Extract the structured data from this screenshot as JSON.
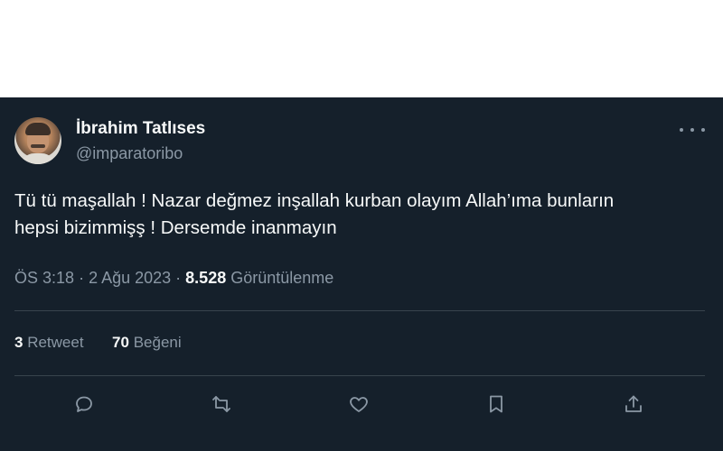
{
  "tweet": {
    "author_name": "İbrahim Tatlıses",
    "author_handle": "@imparatoribo",
    "text_line1": "Tü tü  maşallah ! Nazar değmez inşallah kurban olayım Allah’ıma bunların",
    "text_line2": "hepsi bizimmişş ! Dersemde inanmayın",
    "time": "ÖS 3:18",
    "date": "2 Ağu 2023",
    "views_count": "8.528",
    "views_label": "Görüntülenme",
    "retweet_count": "3",
    "retweet_label": "Retweet",
    "like_count": "70",
    "like_label": "Beğeni"
  },
  "icons": [
    "more-icon",
    "reply-icon",
    "retweet-icon",
    "like-icon",
    "bookmark-icon",
    "share-icon"
  ],
  "colors": {
    "background": "#15202b",
    "text": "#f7f9f9",
    "secondary": "#8b98a5",
    "divider": "#38444d"
  }
}
